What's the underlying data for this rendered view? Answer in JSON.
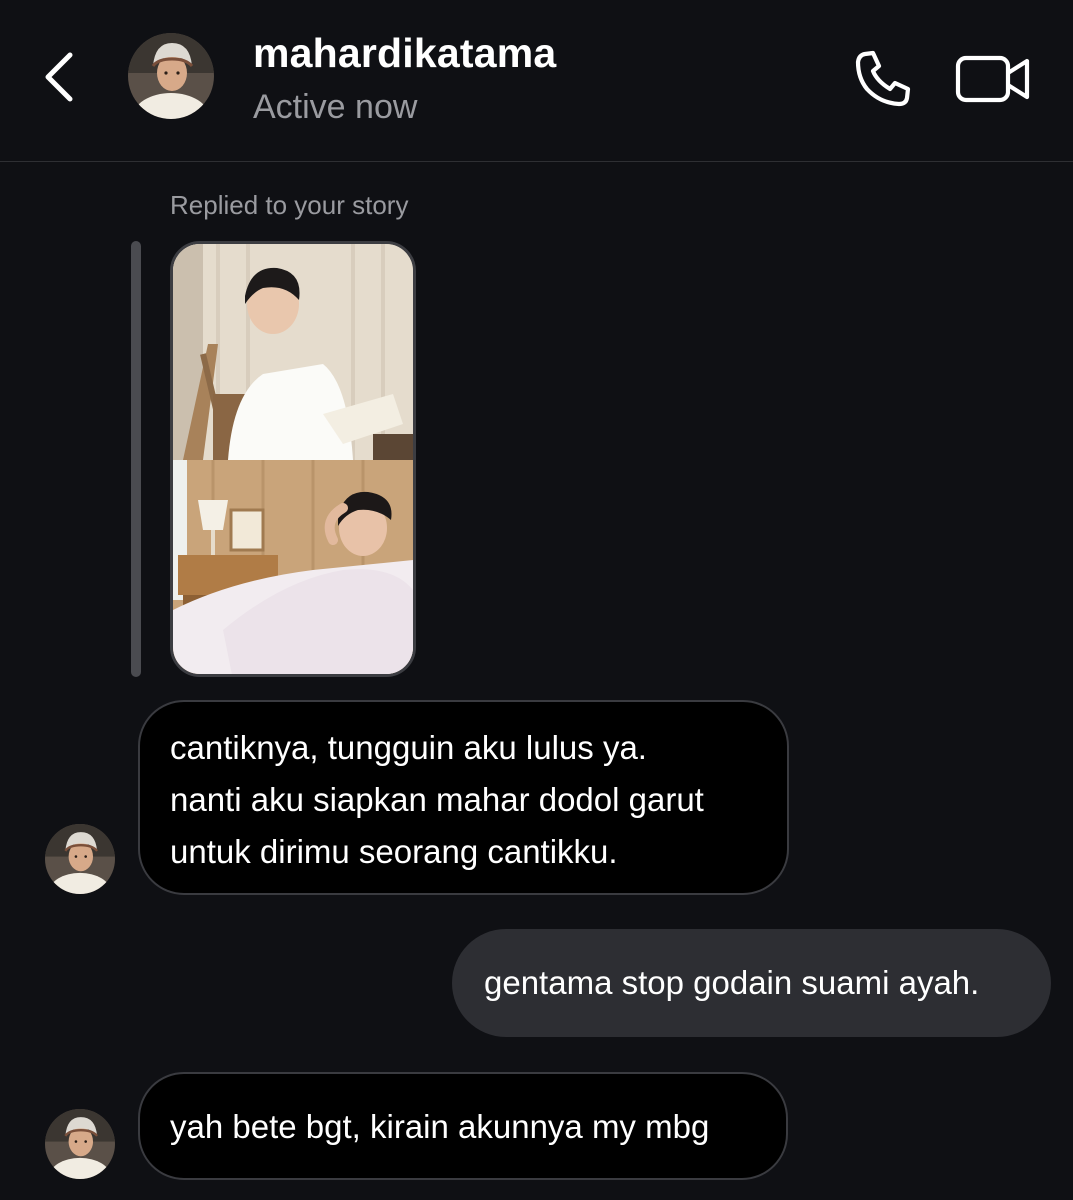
{
  "header": {
    "username": "mahardikatama",
    "status": "Active now",
    "back_icon": "chevron-left-icon",
    "call_icon": "phone-icon",
    "video_icon": "video-camera-icon"
  },
  "story_reply": {
    "caption": "Replied to your story"
  },
  "messages": [
    {
      "direction": "incoming",
      "lines": [
        "cantiknya, tungguin aku lulus ya.",
        "nanti aku siapkan mahar dodol garut",
        "untuk dirimu seorang cantikku."
      ]
    },
    {
      "direction": "outgoing",
      "lines": [
        "gentama stop godain suami ayah."
      ]
    },
    {
      "direction": "incoming",
      "lines": [
        "yah bete bgt, kirain akunnya my mbg"
      ]
    }
  ],
  "colors": {
    "background": "#0f1014",
    "incoming_bubble": "#000000",
    "outgoing_bubble": "#2d2e33",
    "secondary_text": "#9a9ba0"
  }
}
